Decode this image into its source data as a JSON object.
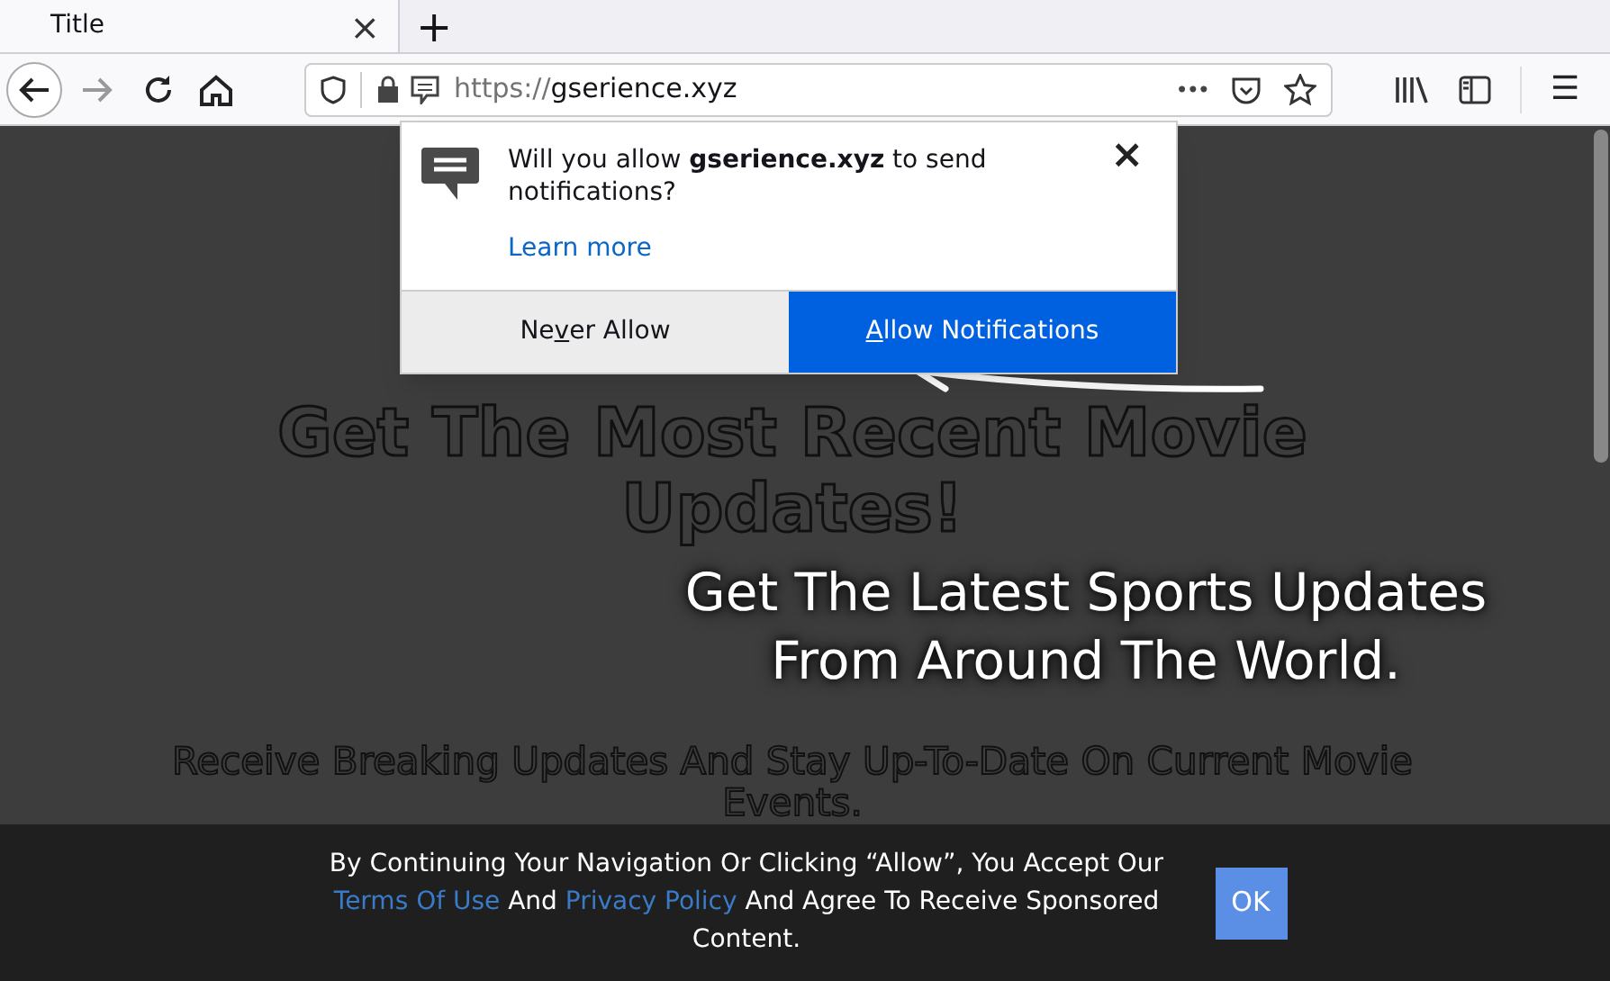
{
  "tab": {
    "title": "Title",
    "close": "×",
    "new_tab": "+"
  },
  "address_bar": {
    "scheme": "https://",
    "domain": "gserience.xyz",
    "more": "•••"
  },
  "menu_icon": "☰",
  "permission_popup": {
    "message": "Will you allow **gserience.xyz** to send notifications?",
    "learn_more": "Learn more",
    "close": "×",
    "buttons": [
      {
        "kind": "secondary",
        "before": "Ne",
        "key": "v",
        "after": "er Allow"
      },
      {
        "kind": "primary",
        "key": "A",
        "after": "llow Notifications"
      }
    ]
  },
  "page": {
    "headline": "Get The Most Recent Movie Updates!",
    "callout": "Get The Latest Sports Updates From Around The World.",
    "subheadline": "Receive Breaking Updates And Stay Up-To-Date On Current Movie Events."
  },
  "consent_bar": {
    "parts": [
      {
        "kind": "text",
        "text": "By Continuing Your Navigation Or Clicking “Allow”, You Accept Our "
      },
      {
        "kind": "link",
        "text": "Terms Of Use"
      },
      {
        "kind": "text",
        "text": " And "
      },
      {
        "kind": "link",
        "text": "Privacy Policy"
      },
      {
        "kind": "text",
        "text": " And Agree To Receive Sponsored Content."
      }
    ],
    "ok": "OK"
  }
}
